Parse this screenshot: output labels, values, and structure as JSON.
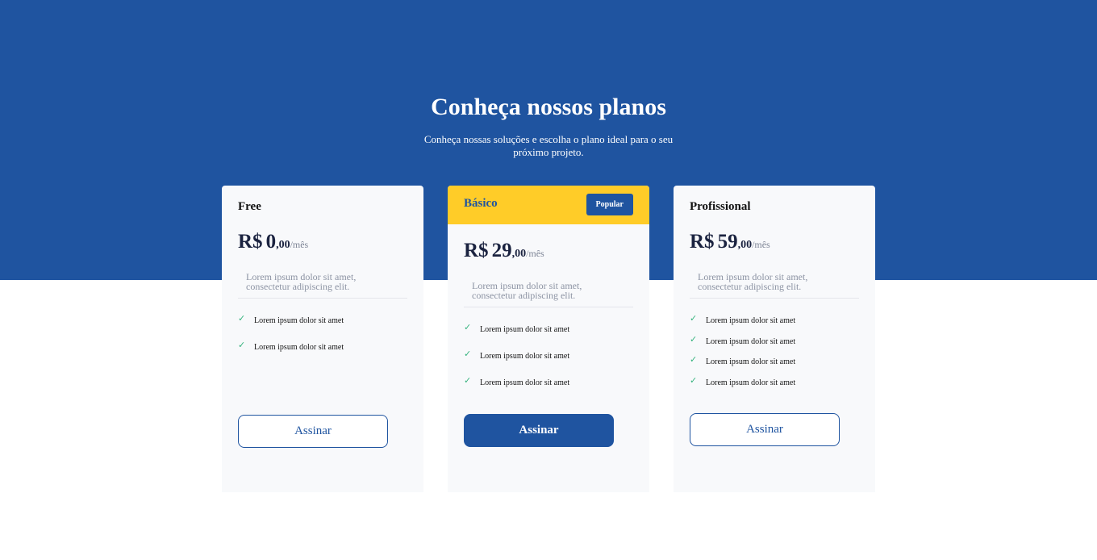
{
  "colors": {
    "primary": "#1f54a0",
    "accent": "#ffcc28",
    "check": "#36b37e"
  },
  "header": {
    "title": "Conheça nossos planos",
    "subtitle": "Conheça nossas soluções e escolha o plano ideal para o seu próximo projeto."
  },
  "plans": [
    {
      "name": "Free",
      "currency": "R$",
      "amount": "0",
      "cents": ",00",
      "period": "/mês",
      "description": "Lorem ipsum dolor sit amet, consectetur adipiscing elit.",
      "features": [
        "Lorem ipsum dolor sit amet",
        "Lorem ipsum dolor sit amet"
      ],
      "button": "Assinar"
    },
    {
      "name": "Básico",
      "badge": "Popular",
      "currency": "R$",
      "amount": "29",
      "cents": ",00",
      "period": "/mês",
      "description": "Lorem ipsum dolor sit amet, consectetur adipiscing elit.",
      "features": [
        "Lorem ipsum dolor sit amet",
        "Lorem ipsum dolor sit amet",
        "Lorem ipsum dolor sit amet"
      ],
      "button": "Assinar"
    },
    {
      "name": "Profissional",
      "currency": "R$",
      "amount": "59",
      "cents": ",00",
      "period": "/mês",
      "description": "Lorem ipsum dolor sit amet, consectetur adipiscing elit.",
      "features": [
        "Lorem ipsum dolor sit amet",
        "Lorem ipsum dolor sit amet",
        "Lorem ipsum dolor sit amet",
        "Lorem ipsum dolor sit amet"
      ],
      "button": "Assinar"
    }
  ]
}
